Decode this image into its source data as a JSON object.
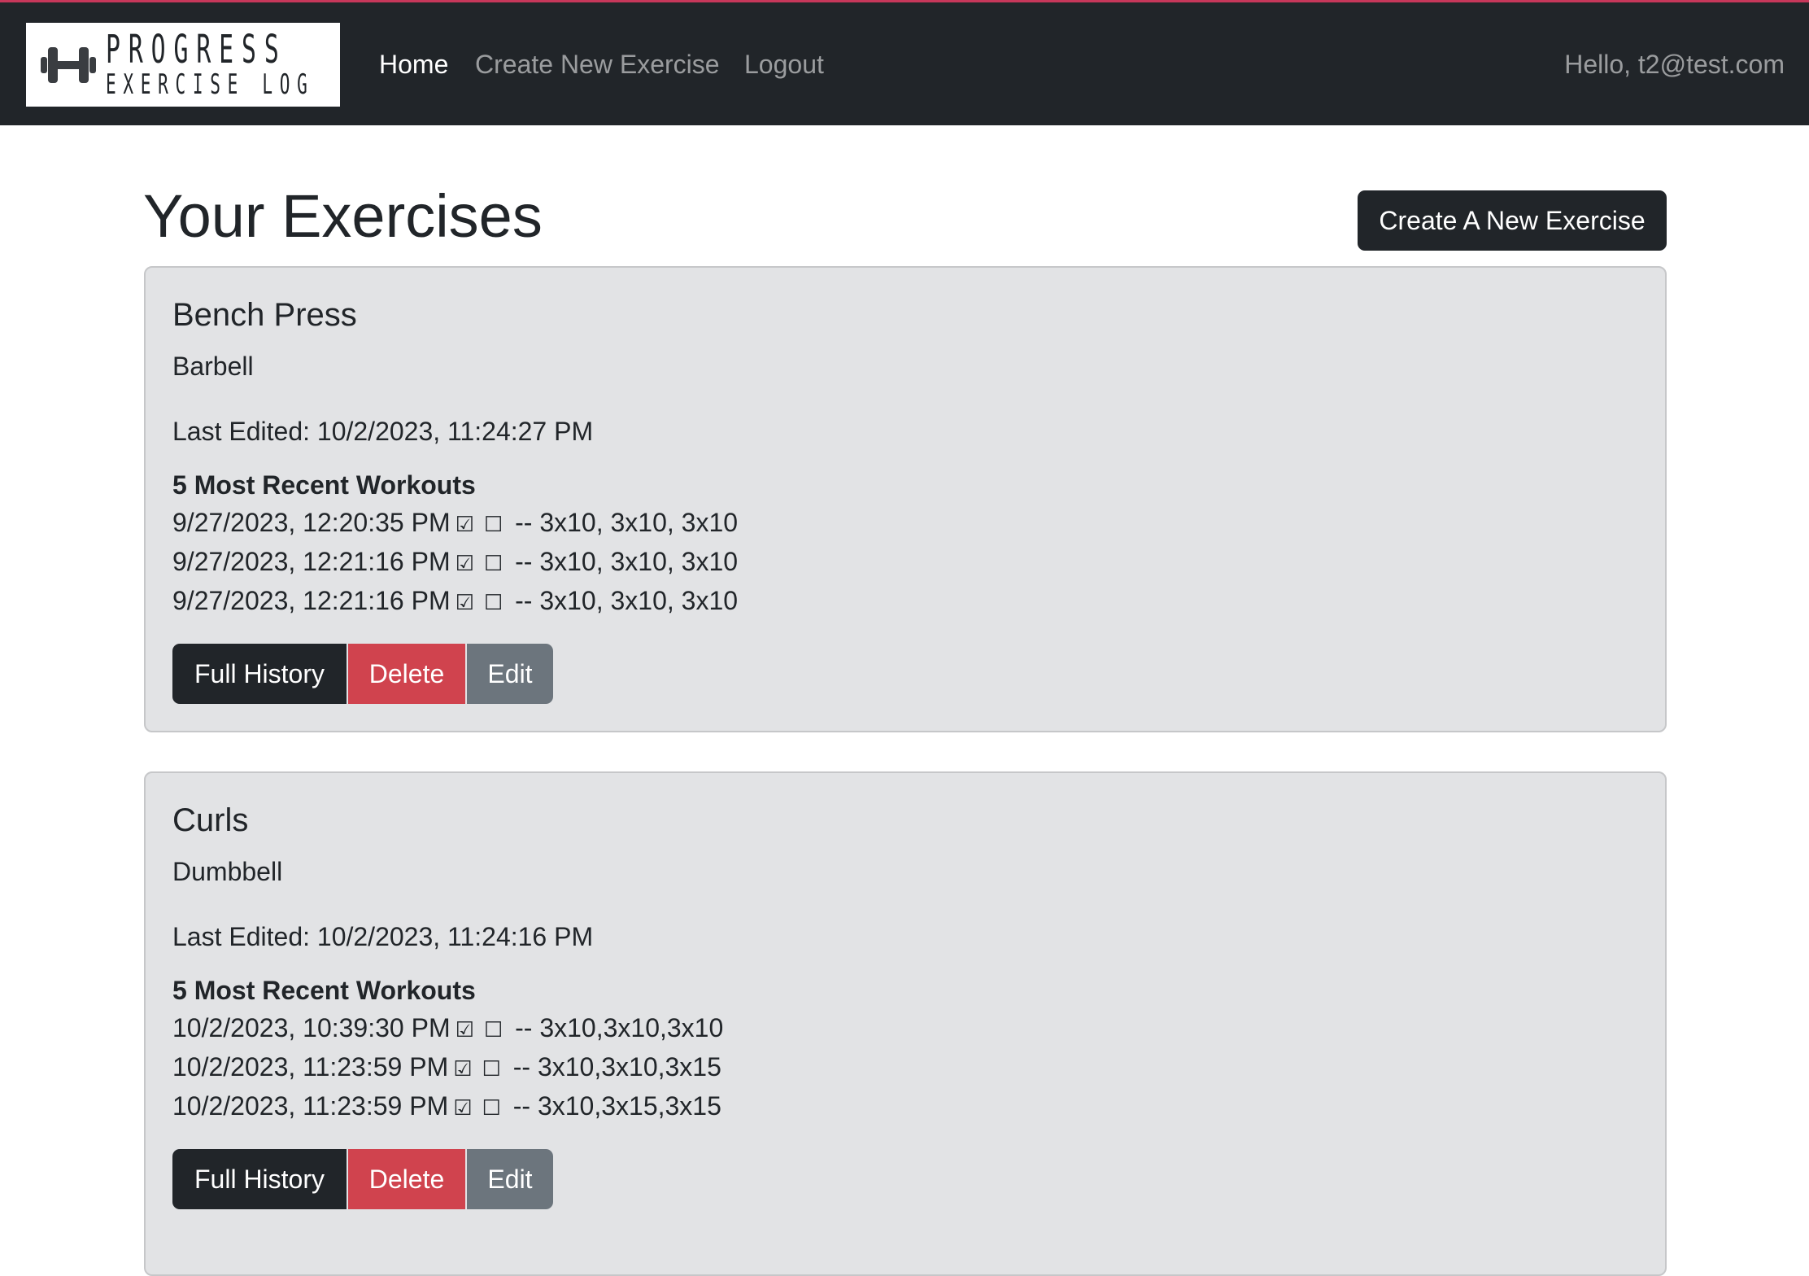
{
  "nav": {
    "brand_top": "PROGRESS",
    "brand_bottom": "EXERCISE LOG",
    "links": [
      "Home",
      "Create New Exercise",
      "Logout"
    ],
    "greeting": "Hello, t2@test.com",
    "accent_color": "#c7375a",
    "brand_icon": "dumbbell-icon"
  },
  "header": {
    "title": "Your Exercises",
    "create_button": "Create A New Exercise"
  },
  "exercises": [
    {
      "name": "Bench Press",
      "equipment": "Barbell",
      "last_edited": "Last Edited: 10/2/2023, 11:24:27 PM",
      "workouts_heading": "5 Most Recent Workouts",
      "workouts": [
        {
          "date": "9/27/2023, 12:20:35 PM",
          "checked": "☑",
          "unchecked": "☐",
          "sets": "-- 3x10, 3x10, 3x10"
        },
        {
          "date": "9/27/2023, 12:21:16 PM",
          "checked": "☑",
          "unchecked": "☐",
          "sets": "-- 3x10, 3x10, 3x10"
        },
        {
          "date": "9/27/2023, 12:21:16 PM",
          "checked": "☑",
          "unchecked": "☐",
          "sets": "-- 3x10, 3x10, 3x10"
        }
      ],
      "actions": {
        "history": "Full History",
        "delete": "Delete",
        "edit": "Edit"
      }
    },
    {
      "name": "Curls",
      "equipment": "Dumbbell",
      "last_edited": "Last Edited: 10/2/2023, 11:24:16 PM",
      "workouts_heading": "5 Most Recent Workouts",
      "workouts": [
        {
          "date": "10/2/2023, 10:39:30 PM",
          "checked": "☑",
          "unchecked": "☐",
          "sets": "-- 3x10,3x10,3x10"
        },
        {
          "date": "10/2/2023, 11:23:59 PM",
          "checked": "☑",
          "unchecked": "☐",
          "sets": "-- 3x10,3x10,3x15"
        },
        {
          "date": "10/2/2023, 11:23:59 PM",
          "checked": "☑",
          "unchecked": "☐",
          "sets": "-- 3x10,3x15,3x15"
        }
      ],
      "actions": {
        "history": "Full History",
        "delete": "Delete",
        "edit": "Edit"
      }
    }
  ]
}
